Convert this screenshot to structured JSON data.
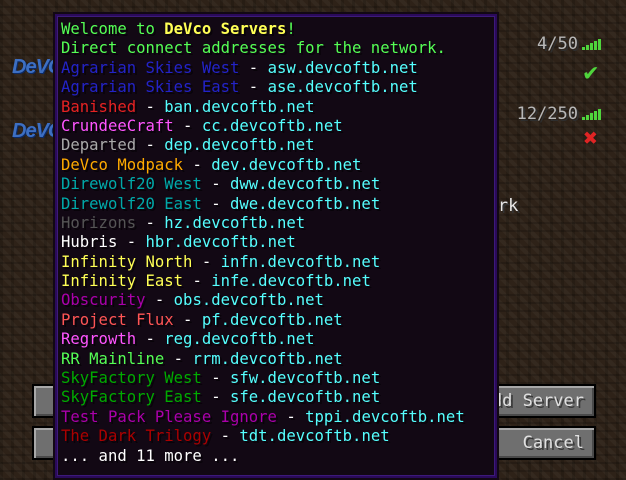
{
  "servers": [
    {
      "players": "4/50",
      "status_icon": "check-icon",
      "status_color": "#4fd43c"
    },
    {
      "players": "12/250",
      "status_icon": "cross-icon",
      "status_color": "#e02424"
    }
  ],
  "motd_visible_tail": "al network",
  "buttons": {
    "add_server": "Add Server",
    "cancel": "Cancel"
  },
  "tooltip": {
    "title_prefix": "Welcome to ",
    "title_brand": "DeVco Servers",
    "title_suffix": "!",
    "subtitle": "Direct connect addresses for the network.",
    "separator": " - ",
    "entries": [
      {
        "name": "Agrarian Skies West",
        "addr": "asw.devcoftb.net",
        "color": "#2323c8"
      },
      {
        "name": "Agrarian Skies East",
        "addr": "ase.devcoftb.net",
        "color": "#2323c8"
      },
      {
        "name": "Banished",
        "addr": "ban.devcoftb.net",
        "color": "#e62222"
      },
      {
        "name": "CrundeeCraft",
        "addr": "cc.devcoftb.net",
        "color": "#ff55ff"
      },
      {
        "name": "Departed",
        "addr": "dep.devcoftb.net",
        "color": "#aaaaaa"
      },
      {
        "name": "DeVco Modpack",
        "addr": "dev.devcoftb.net",
        "color": "#ffaa00"
      },
      {
        "name": "Direwolf20 West",
        "addr": "dww.devcoftb.net",
        "color": "#00aaaa"
      },
      {
        "name": "Direwolf20 East",
        "addr": "dwe.devcoftb.net",
        "color": "#00aaaa"
      },
      {
        "name": "Horizons",
        "addr": "hz.devcoftb.net",
        "color": "#555555"
      },
      {
        "name": "Hubris",
        "addr": "hbr.devcoftb.net",
        "color": "#ffffff"
      },
      {
        "name": "Infinity North",
        "addr": "infn.devcoftb.net",
        "color": "#ffff55"
      },
      {
        "name": "Infinity East",
        "addr": "infe.devcoftb.net",
        "color": "#ffff55"
      },
      {
        "name": "Obscurity",
        "addr": "obs.devcoftb.net",
        "color": "#aa00aa"
      },
      {
        "name": "Project Flux",
        "addr": "pf.devcoftb.net",
        "color": "#ff5555"
      },
      {
        "name": "Regrowth",
        "addr": "reg.devcoftb.net",
        "color": "#ff55ff"
      },
      {
        "name": "RR Mainline",
        "addr": "rrm.devcoftb.net",
        "color": "#55ff55"
      },
      {
        "name": "SkyFactory West",
        "addr": "sfw.devcoftb.net",
        "color": "#00aa00"
      },
      {
        "name": "SkyFactory East",
        "addr": "sfe.devcoftb.net",
        "color": "#00aa00"
      },
      {
        "name": "Test Pack Please Ignore",
        "addr": "tppi.devcoftb.net",
        "color": "#aa00aa"
      },
      {
        "name": "The Dark Trilogy",
        "addr": "tdt.devcoftb.net",
        "color": "#aa0000"
      }
    ],
    "more": "... and 11 more ..."
  },
  "colors": {
    "title": "#55ff55",
    "brand": "#ffff55",
    "address": "#55ffff",
    "more": "#ffffff"
  }
}
